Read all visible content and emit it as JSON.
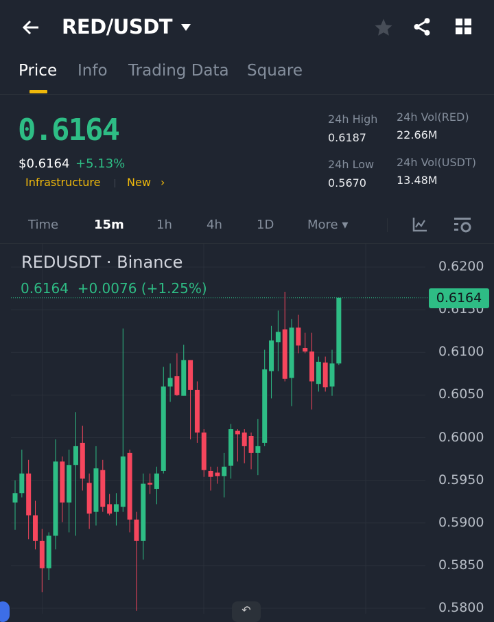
{
  "header": {
    "title": "RED/USDT",
    "back_icon": "arrow-left-icon",
    "dropdown_icon": "caret-down-icon",
    "icons": [
      "star-icon",
      "share-icon",
      "grid-icon"
    ]
  },
  "tabs": [
    {
      "label": "Price"
    },
    {
      "label": "Info"
    },
    {
      "label": "Trading Data"
    },
    {
      "label": "Square"
    }
  ],
  "summary": {
    "price": "0.6164",
    "usd_price": "$0.6164",
    "change_pct": "+5.13%",
    "tags": [
      "Infrastructure",
      "New"
    ],
    "tag_arrow": "›",
    "stats": [
      {
        "label": "24h High",
        "value": "0.6187"
      },
      {
        "label": "24h Vol(RED)",
        "value": "22.66M"
      },
      {
        "label": "24h Low",
        "value": "0.5670"
      },
      {
        "label": "24h Vol(USDT)",
        "value": "13.48M"
      }
    ]
  },
  "timeframes": [
    {
      "label": "Time"
    },
    {
      "label": "15m"
    },
    {
      "label": "1h"
    },
    {
      "label": "4h"
    },
    {
      "label": "1D"
    },
    {
      "label": "More ▾"
    }
  ],
  "colors": {
    "up": "#2ebd85",
    "down": "#f6465d",
    "accent": "#f0b90b",
    "bg": "#1f2530"
  },
  "chart_data": {
    "type": "candlestick",
    "title": "REDUSDT · Binance",
    "legend": "0.6164  +0.0076 (+1.25%)",
    "current_price": 0.6164,
    "current_price_label": "0.6164",
    "ylim": [
      0.58,
      0.6227
    ],
    "yticks": [
      "0.6200",
      "0.6150",
      "0.6100",
      "0.6050",
      "0.6000",
      "0.5950",
      "0.5900",
      "0.5850",
      "0.5800"
    ],
    "ohlc": [
      [
        0.5924,
        0.595,
        0.5892,
        0.5935
      ],
      [
        0.5935,
        0.5986,
        0.593,
        0.5958
      ],
      [
        0.5958,
        0.5974,
        0.5881,
        0.5909
      ],
      [
        0.5909,
        0.5926,
        0.5869,
        0.5879
      ],
      [
        0.5879,
        0.5893,
        0.5819,
        0.5847
      ],
      [
        0.5847,
        0.5889,
        0.5833,
        0.5885
      ],
      [
        0.5885,
        0.5998,
        0.5869,
        0.5972
      ],
      [
        0.5972,
        0.5978,
        0.5901,
        0.5924
      ],
      [
        0.5924,
        0.5986,
        0.5889,
        0.5968
      ],
      [
        0.5968,
        0.603,
        0.5885,
        0.599
      ],
      [
        0.5994,
        0.6014,
        0.5938,
        0.5952
      ],
      [
        0.5947,
        0.5958,
        0.5893,
        0.5911
      ],
      [
        0.5913,
        0.599,
        0.5897,
        0.5964
      ],
      [
        0.5962,
        0.5974,
        0.5913,
        0.5919
      ],
      [
        0.5922,
        0.5934,
        0.5909,
        0.5911
      ],
      [
        0.5913,
        0.5935,
        0.5897,
        0.5922
      ],
      [
        0.5919,
        0.6128,
        0.5913,
        0.5978
      ],
      [
        0.5982,
        0.5986,
        0.5889,
        0.5904
      ],
      [
        0.5904,
        0.5913,
        0.5797,
        0.5879
      ],
      [
        0.5879,
        0.5958,
        0.5857,
        0.5946
      ],
      [
        0.5947,
        0.5958,
        0.5934,
        0.5945
      ],
      [
        0.594,
        0.5966,
        0.5922,
        0.5958
      ],
      [
        0.5961,
        0.6083,
        0.5958,
        0.606
      ],
      [
        0.606,
        0.6087,
        0.6042,
        0.607
      ],
      [
        0.6072,
        0.6099,
        0.6049,
        0.605
      ],
      [
        0.6049,
        0.6109,
        0.6049,
        0.6091
      ],
      [
        0.6091,
        0.6091,
        0.5998,
        0.6056
      ],
      [
        0.6056,
        0.6066,
        0.5994,
        0.6006
      ],
      [
        0.6006,
        0.601,
        0.5954,
        0.5962
      ],
      [
        0.5961,
        0.5966,
        0.5938,
        0.5954
      ],
      [
        0.5959,
        0.5966,
        0.5946,
        0.5955
      ],
      [
        0.5955,
        0.5982,
        0.593,
        0.5966
      ],
      [
        0.5967,
        0.6016,
        0.5952,
        0.601
      ],
      [
        0.6008,
        0.601,
        0.5972,
        0.6004
      ],
      [
        0.6006,
        0.601,
        0.597,
        0.599
      ],
      [
        0.6002,
        0.6006,
        0.5963,
        0.5982
      ],
      [
        0.5982,
        0.6022,
        0.5956,
        0.599
      ],
      [
        0.5994,
        0.6103,
        0.599,
        0.608
      ],
      [
        0.6078,
        0.6131,
        0.6046,
        0.6114
      ],
      [
        0.6112,
        0.6149,
        0.6078,
        0.6124
      ],
      [
        0.6127,
        0.6171,
        0.6066,
        0.6069
      ],
      [
        0.607,
        0.6139,
        0.6037,
        0.6129
      ],
      [
        0.6129,
        0.6144,
        0.6099,
        0.6108
      ],
      [
        0.6105,
        0.6123,
        0.6099,
        0.6101
      ],
      [
        0.6101,
        0.6123,
        0.6033,
        0.6066
      ],
      [
        0.6063,
        0.6095,
        0.6054,
        0.6089
      ],
      [
        0.6088,
        0.6095,
        0.6054,
        0.6059
      ],
      [
        0.606,
        0.6103,
        0.6049,
        0.6087
      ],
      [
        0.6087,
        0.6164,
        0.6085,
        0.6164
      ]
    ]
  }
}
